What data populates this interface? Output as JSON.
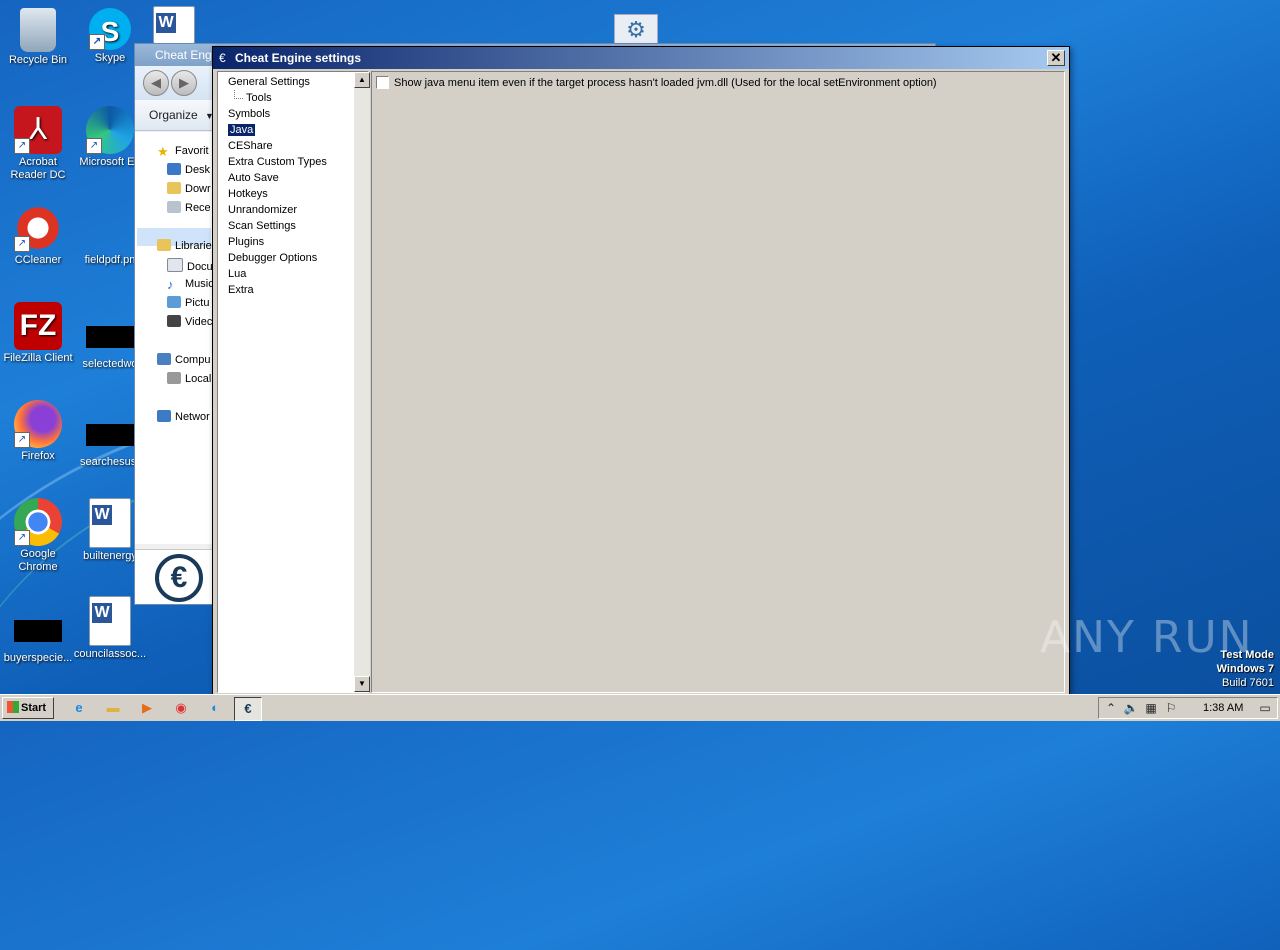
{
  "desktop": {
    "icons": [
      {
        "label": "Recycle Bin"
      },
      {
        "label": "Skype"
      },
      {
        "label": "Acrobat Reader DC"
      },
      {
        "label": "Microsoft Ed"
      },
      {
        "label": "CCleaner"
      },
      {
        "label": "fieldpdf.pn"
      },
      {
        "label": "FileZilla Client"
      },
      {
        "label": "selectedwo"
      },
      {
        "label": "Firefox"
      },
      {
        "label": "searchesusr"
      },
      {
        "label": "Google Chrome"
      },
      {
        "label": "builtenergy"
      },
      {
        "label": "buyerspecie..."
      },
      {
        "label": "councilassoc..."
      }
    ]
  },
  "explorer": {
    "title": "Cheat Eng",
    "toolbar_organize": "Organize",
    "tree": [
      "Favorit",
      "Desk",
      "Dowr",
      "Rece",
      "Librarie",
      "Docu",
      "Music",
      "Pictu",
      "Videc",
      "Compu",
      "Local",
      "Networ"
    ]
  },
  "dialog": {
    "title": "Cheat Engine settings",
    "close_label": "✕",
    "nav_items": [
      {
        "label": "General Settings"
      },
      {
        "label": "Tools"
      },
      {
        "label": "Symbols"
      },
      {
        "label": "Java"
      },
      {
        "label": "CEShare"
      },
      {
        "label": "Extra Custom Types"
      },
      {
        "label": "Auto Save"
      },
      {
        "label": "Hotkeys"
      },
      {
        "label": "Unrandomizer"
      },
      {
        "label": "Scan Settings"
      },
      {
        "label": "Plugins"
      },
      {
        "label": "Debugger Options"
      },
      {
        "label": "Lua"
      },
      {
        "label": "Extra"
      }
    ],
    "selected_item": "Java",
    "java_option": {
      "label": "Show java menu item even if the target process hasn't loaded jvm.dll (Used for the local setEnvironment option)",
      "checked": false
    }
  },
  "watermark": "ANY RUN",
  "system_text": {
    "line1": "Test Mode",
    "line2": "Windows 7",
    "line3": "Build 7601"
  },
  "taskbar": {
    "start_label": "Start",
    "clock": "1:38 AM"
  }
}
